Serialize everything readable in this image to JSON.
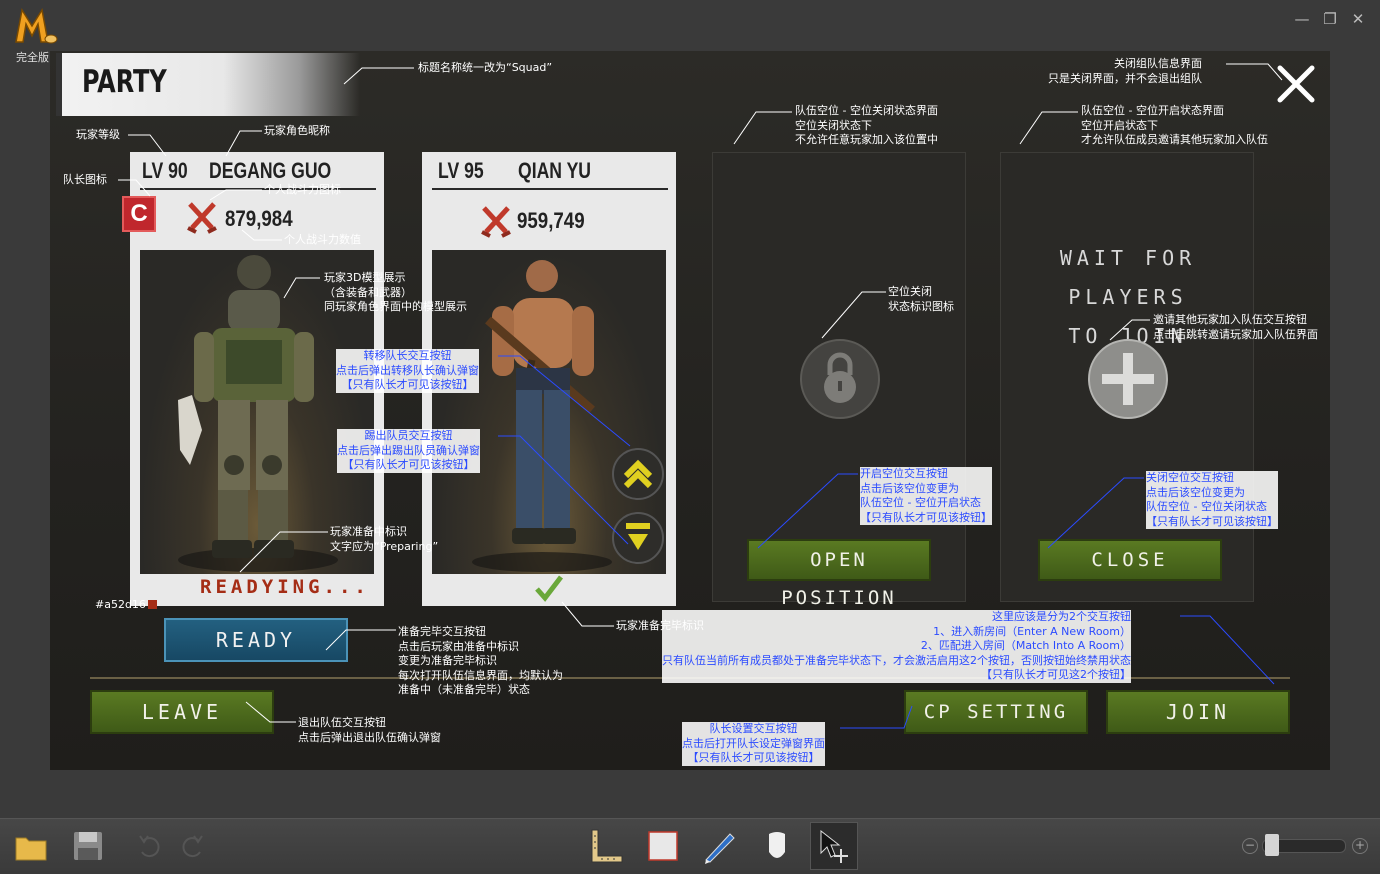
{
  "app": {
    "logo_label": "完全版"
  },
  "window": {
    "minimize": "—",
    "maximize": "❐",
    "close": "✕"
  },
  "party": {
    "title": "PARTY",
    "players": [
      {
        "level": "LV 90",
        "name": "DEGANG GUO",
        "power": "879,984",
        "captain_badge": "C",
        "status": "READYING..."
      },
      {
        "level": "LV 95",
        "name": "QIAN YU",
        "power": "959,749",
        "status_icon": "checkmark-icon"
      }
    ],
    "slot_open_text": "WAIT FOR PLAYERS TO JOIN",
    "buttons": {
      "ready": "READY",
      "open_position": "OPEN POSITION",
      "close": "CLOSE",
      "leave": "LEAVE",
      "cp_setting": "CP SETTING",
      "join": "JOIN"
    },
    "colors": {
      "readying": "#a52d16",
      "accent_green": "#4a6a1c",
      "ready_blue": "#1d5a7a"
    }
  },
  "annotations": {
    "title_note": "标题名称统一改为“Squad”",
    "close_note": "关闭组队信息界面\n只是关闭界面，并不会退出组队",
    "slot_closed_note": "队伍空位 - 空位关闭状态界面\n空位关闭状态下\n不允许任意玩家加入该位置中",
    "slot_open_note": "队伍空位 - 空位开启状态界面\n空位开启状态下\n才允许队伍成员邀请其他玩家加入队伍",
    "player_level": "玩家等级",
    "player_name": "玩家角色昵称",
    "captain_icon": "队长图标",
    "power_icon": "个人战斗力图标",
    "power_value": "个人战斗力数值",
    "model_note": "玩家3D模型展示\n（含装备和武器）\n同玩家角色界面中的模型展示",
    "transfer_note": "转移队长交互按钮\n点击后弹出转移队长确认弹窗\n【只有队长才可见该按钮】",
    "kick_note": "踢出队员交互按钮\n点击后弹出踢出队员确认弹窗\n【只有队长才可见该按钮】",
    "lock_note": "空位关闭\n状态标识图标",
    "invite_note": "邀请其他玩家加入队伍交互按钮\n点击后跳转邀请玩家加入队伍界面",
    "open_pos_note": "开启空位交互按钮\n点击后该空位变更为\n队伍空位 - 空位开启状态\n【只有队长才可见该按钮】",
    "close_pos_note": "关闭空位交互按钮\n点击后该空位变更为\n队伍空位 - 空位关闭状态\n【只有队长才可见该按钮】",
    "readying_note": "玩家准备中标识\n文字应为“Preparing”",
    "color_tag": "#a52d16",
    "ready_done_note": "玩家准备完毕标识",
    "ready_btn_note": "准备完毕交互按钮\n点击后玩家由准备中标识\n变更为准备完毕标识\n每次打开队伍信息界面，均默认为\n准备中（未准备完毕）状态",
    "leave_note": "退出队伍交互按钮\n点击后弹出退出队伍确认弹窗",
    "cp_note": "队长设置交互按钮\n点击后打开队长设定弹窗界面\n【只有队长才可见该按钮】",
    "join_note": "这里应该是分为2个交互按钮\n1、进入新房间（Enter A New Room）\n2、匹配进入房间（Match Into A Room）\n只有队伍当前所有成员都处于准备完毕状态下，才会激活启用这2个按钮，否则按钮始终禁用状态\n【只有队长才可见这2个按钮】"
  }
}
